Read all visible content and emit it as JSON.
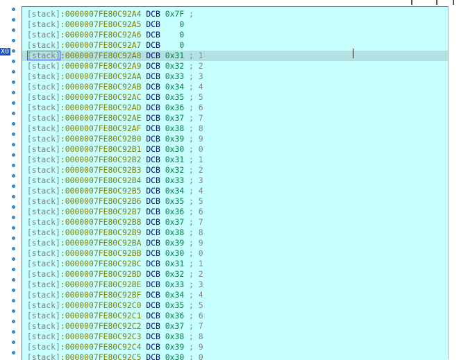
{
  "window": {
    "marker_label": "X0"
  },
  "rows": [
    {
      "seg": "[stack]",
      "addr": ":0000007FE80C92A4",
      "mn": "DCB",
      "val": " 0x7F",
      "cmt": " ;"
    },
    {
      "seg": "[stack]",
      "addr": ":0000007FE80C92A5",
      "mn": "DCB",
      "val": "    0",
      "cmt": ""
    },
    {
      "seg": "[stack]",
      "addr": ":0000007FE80C92A6",
      "mn": "DCB",
      "val": "    0",
      "cmt": ""
    },
    {
      "seg": "[stack]",
      "addr": ":0000007FE80C92A7",
      "mn": "DCB",
      "val": "    0",
      "cmt": ""
    },
    {
      "seg": "[stack]",
      "addr": ":0000007FE80C92A8",
      "mn": "DCB",
      "val": " 0x31",
      "cmt": " ; 1"
    },
    {
      "seg": "[stack]",
      "addr": ":0000007FE80C92A9",
      "mn": "DCB",
      "val": " 0x32",
      "cmt": " ; 2"
    },
    {
      "seg": "[stack]",
      "addr": ":0000007FE80C92AA",
      "mn": "DCB",
      "val": " 0x33",
      "cmt": " ; 3"
    },
    {
      "seg": "[stack]",
      "addr": ":0000007FE80C92AB",
      "mn": "DCB",
      "val": " 0x34",
      "cmt": " ; 4"
    },
    {
      "seg": "[stack]",
      "addr": ":0000007FE80C92AC",
      "mn": "DCB",
      "val": " 0x35",
      "cmt": " ; 5"
    },
    {
      "seg": "[stack]",
      "addr": ":0000007FE80C92AD",
      "mn": "DCB",
      "val": " 0x36",
      "cmt": " ; 6"
    },
    {
      "seg": "[stack]",
      "addr": ":0000007FE80C92AE",
      "mn": "DCB",
      "val": " 0x37",
      "cmt": " ; 7"
    },
    {
      "seg": "[stack]",
      "addr": ":0000007FE80C92AF",
      "mn": "DCB",
      "val": " 0x38",
      "cmt": " ; 8"
    },
    {
      "seg": "[stack]",
      "addr": ":0000007FE80C92B0",
      "mn": "DCB",
      "val": " 0x39",
      "cmt": " ; 9"
    },
    {
      "seg": "[stack]",
      "addr": ":0000007FE80C92B1",
      "mn": "DCB",
      "val": " 0x30",
      "cmt": " ; 0"
    },
    {
      "seg": "[stack]",
      "addr": ":0000007FE80C92B2",
      "mn": "DCB",
      "val": " 0x31",
      "cmt": " ; 1"
    },
    {
      "seg": "[stack]",
      "addr": ":0000007FE80C92B3",
      "mn": "DCB",
      "val": " 0x32",
      "cmt": " ; 2"
    },
    {
      "seg": "[stack]",
      "addr": ":0000007FE80C92B4",
      "mn": "DCB",
      "val": " 0x33",
      "cmt": " ; 3"
    },
    {
      "seg": "[stack]",
      "addr": ":0000007FE80C92B5",
      "mn": "DCB",
      "val": " 0x34",
      "cmt": " ; 4"
    },
    {
      "seg": "[stack]",
      "addr": ":0000007FE80C92B6",
      "mn": "DCB",
      "val": " 0x35",
      "cmt": " ; 5"
    },
    {
      "seg": "[stack]",
      "addr": ":0000007FE80C92B7",
      "mn": "DCB",
      "val": " 0x36",
      "cmt": " ; 6"
    },
    {
      "seg": "[stack]",
      "addr": ":0000007FE80C92B8",
      "mn": "DCB",
      "val": " 0x37",
      "cmt": " ; 7"
    },
    {
      "seg": "[stack]",
      "addr": ":0000007FE80C92B9",
      "mn": "DCB",
      "val": " 0x38",
      "cmt": " ; 8"
    },
    {
      "seg": "[stack]",
      "addr": ":0000007FE80C92BA",
      "mn": "DCB",
      "val": " 0x39",
      "cmt": " ; 9"
    },
    {
      "seg": "[stack]",
      "addr": ":0000007FE80C92BB",
      "mn": "DCB",
      "val": " 0x30",
      "cmt": " ; 0"
    },
    {
      "seg": "[stack]",
      "addr": ":0000007FE80C92BC",
      "mn": "DCB",
      "val": " 0x31",
      "cmt": " ; 1"
    },
    {
      "seg": "[stack]",
      "addr": ":0000007FE80C92BD",
      "mn": "DCB",
      "val": " 0x32",
      "cmt": " ; 2"
    },
    {
      "seg": "[stack]",
      "addr": ":0000007FE80C92BE",
      "mn": "DCB",
      "val": " 0x33",
      "cmt": " ; 3"
    },
    {
      "seg": "[stack]",
      "addr": ":0000007FE80C92BF",
      "mn": "DCB",
      "val": " 0x34",
      "cmt": " ; 4"
    },
    {
      "seg": "[stack]",
      "addr": ":0000007FE80C92C0",
      "mn": "DCB",
      "val": " 0x35",
      "cmt": " ; 5"
    },
    {
      "seg": "[stack]",
      "addr": ":0000007FE80C92C1",
      "mn": "DCB",
      "val": " 0x36",
      "cmt": " ; 6"
    },
    {
      "seg": "[stack]",
      "addr": ":0000007FE80C92C2",
      "mn": "DCB",
      "val": " 0x37",
      "cmt": " ; 7"
    },
    {
      "seg": "[stack]",
      "addr": ":0000007FE80C92C3",
      "mn": "DCB",
      "val": " 0x38",
      "cmt": " ; 8"
    },
    {
      "seg": "[stack]",
      "addr": ":0000007FE80C92C4",
      "mn": "DCB",
      "val": " 0x39",
      "cmt": " ; 9"
    },
    {
      "seg": "[stack]",
      "addr": ":0000007FE80C92C5",
      "mn": "DCB",
      "val": " 0x30",
      "cmt": " ; 0"
    }
  ],
  "current_row": 4,
  "colors": {
    "background": "#c8ffff",
    "current_line": "#b3e1e1",
    "segment": "#7f7f7f",
    "address": "#808000",
    "mnemonic": "#000080",
    "value": "#008040",
    "comment": "#808080",
    "breakpoint_dot": "#2e8bd6"
  }
}
